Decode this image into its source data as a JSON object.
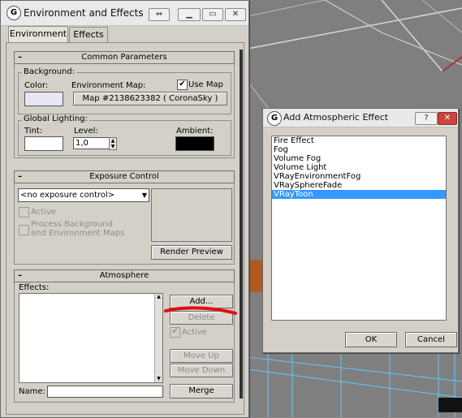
{
  "colors": {
    "window_bg": "#d4d0c8",
    "selection": "#3399ff",
    "annotation_stroke": "#e01010",
    "background_swatch": "#e8e6f4",
    "tint_swatch": "#ffffff",
    "ambient_swatch": "#000000"
  },
  "env_window": {
    "title": "Environment and Effects",
    "icon": "3dsmax-icon",
    "tabs": [
      {
        "label": "Environment",
        "active": true
      },
      {
        "label": "Effects",
        "active": false
      }
    ],
    "common_parameters": {
      "header": "Common Parameters",
      "background_group": "Background:",
      "color_label": "Color:",
      "env_map_label": "Environment Map:",
      "use_map_label": "Use Map",
      "use_map_checked": true,
      "map_button": "Map #2138623382  ( CoronaSky )",
      "lighting_group": "Global Lighting:",
      "tint_label": "Tint:",
      "level_label": "Level:",
      "level_value": "1,0",
      "ambient_label": "Ambient:"
    },
    "exposure_control": {
      "header": "Exposure Control",
      "dropdown_value": "<no exposure control>",
      "active_label": "Active",
      "process_bg_label_1": "Process Background",
      "process_bg_label_2": "and Environment Maps",
      "render_preview": "Render Preview"
    },
    "atmosphere": {
      "header": "Atmosphere",
      "effects_label": "Effects:",
      "add_button": "Add...",
      "delete_button": "Delete",
      "active_label": "Active",
      "move_up": "Move Up",
      "move_down": "Move Down",
      "name_label": "Name:",
      "merge_button": "Merge"
    }
  },
  "dialog": {
    "title": "Add Atmospheric Effect",
    "help": "?",
    "items": [
      {
        "label": "Fire Effect",
        "selected": false
      },
      {
        "label": "Fog",
        "selected": false
      },
      {
        "label": "Volume Fog",
        "selected": false
      },
      {
        "label": "Volume Light",
        "selected": false
      },
      {
        "label": "VRayEnvironmentFog",
        "selected": false
      },
      {
        "label": "VRaySphereFade",
        "selected": false
      },
      {
        "label": "VRayToon",
        "selected": true
      }
    ],
    "ok": "OK",
    "cancel": "Cancel"
  }
}
